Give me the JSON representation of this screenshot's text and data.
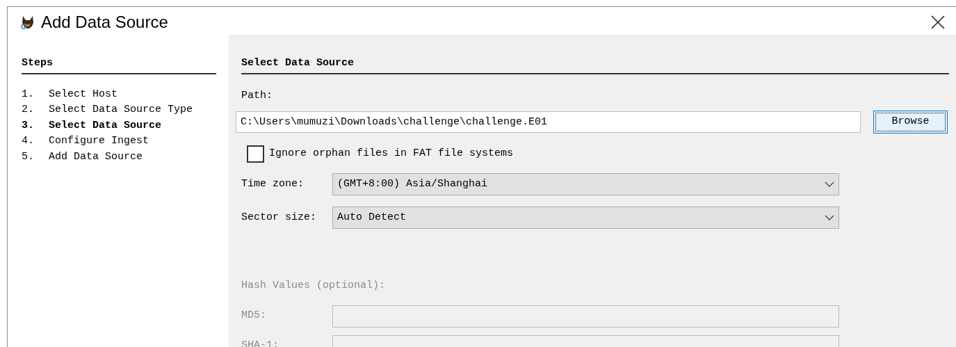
{
  "window": {
    "title": "Add Data Source"
  },
  "steps": {
    "title": "Steps",
    "items": [
      {
        "number": "1.",
        "label": "Select Host",
        "selected": false
      },
      {
        "number": "2.",
        "label": "Select Data Source Type",
        "selected": false
      },
      {
        "number": "3.",
        "label": "Select Data Source",
        "selected": true
      },
      {
        "number": "4.",
        "label": "Configure Ingest",
        "selected": false
      },
      {
        "number": "5.",
        "label": "Add Data Source",
        "selected": false
      }
    ]
  },
  "panel": {
    "title": "Select Data Source",
    "path": {
      "label": "Path:",
      "value": "C:\\Users\\mumuzi\\Downloads\\challenge\\challenge.E01"
    },
    "browse_button": {
      "label": "Browse",
      "focused": true
    },
    "ignore_orphans": {
      "label": "Ignore orphan files in FAT file systems",
      "checked": false
    },
    "selects": [
      {
        "label": "Time zone:",
        "value": "(GMT+8:00) Asia/Shanghai"
      },
      {
        "label": "Sector size:",
        "value": "Auto Detect"
      }
    ],
    "hash": {
      "title": "Hash Values (optional):",
      "disabled": true,
      "fields": [
        {
          "label": "MD5:"
        },
        {
          "label": "SHA-1:"
        }
      ]
    }
  }
}
